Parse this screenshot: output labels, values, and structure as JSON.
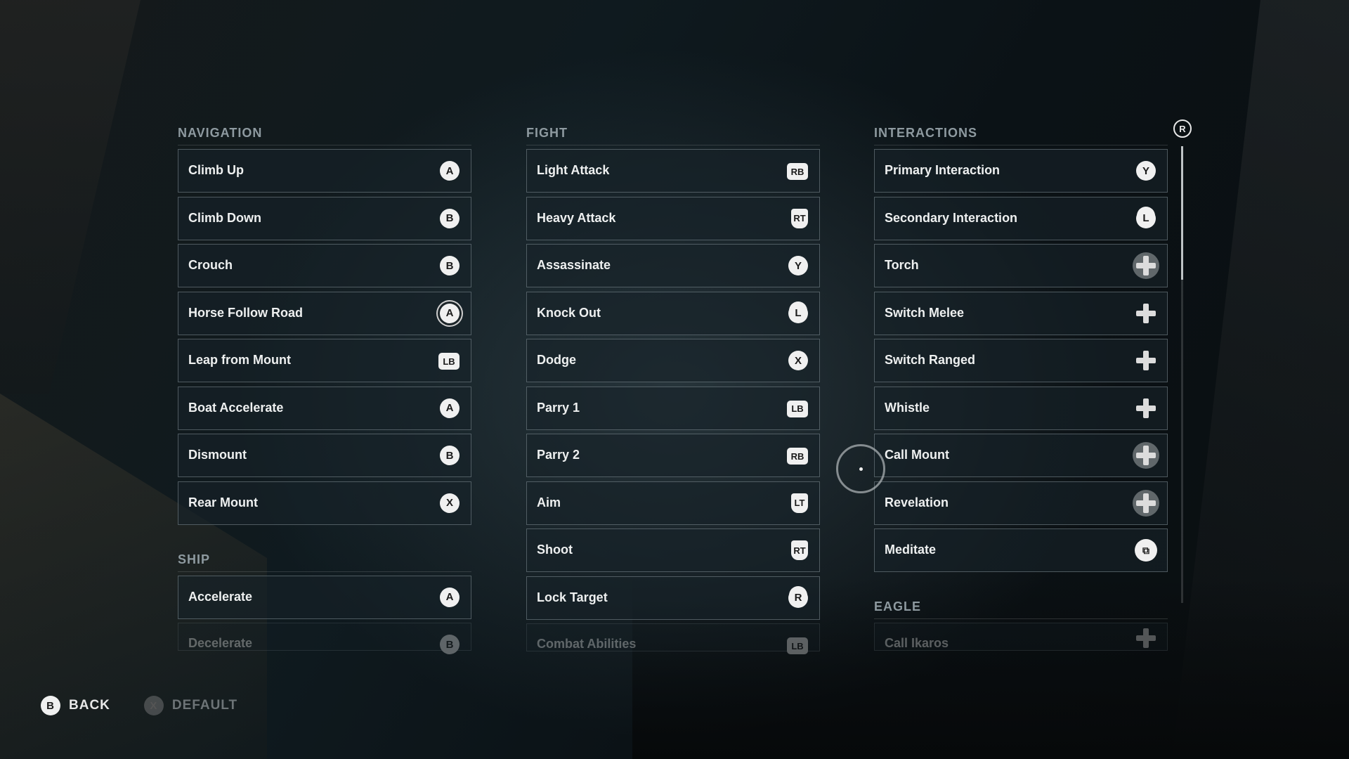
{
  "sections": {
    "navigation": {
      "title": "NAVIGATION",
      "rows": [
        {
          "label": "Climb Up",
          "button": "A"
        },
        {
          "label": "Climb Down",
          "button": "B"
        },
        {
          "label": "Crouch",
          "button": "B"
        },
        {
          "label": "Horse Follow Road",
          "button": "A"
        },
        {
          "label": "Leap from Mount",
          "button": "LB"
        },
        {
          "label": "Boat Accelerate",
          "button": "A"
        },
        {
          "label": "Dismount",
          "button": "B"
        },
        {
          "label": "Rear Mount",
          "button": "X"
        }
      ]
    },
    "ship": {
      "title": "SHIP",
      "rows": [
        {
          "label": "Accelerate",
          "button": "A"
        },
        {
          "label": "Decelerate",
          "button": "B"
        }
      ]
    },
    "fight": {
      "title": "FIGHT",
      "rows": [
        {
          "label": "Light Attack",
          "button": "RB"
        },
        {
          "label": "Heavy Attack",
          "button": "RT"
        },
        {
          "label": "Assassinate",
          "button": "Y"
        },
        {
          "label": "Knock Out",
          "button": "L"
        },
        {
          "label": "Dodge",
          "button": "X"
        },
        {
          "label": "Parry 1",
          "button": "LB"
        },
        {
          "label": "Parry 2",
          "button": "RB"
        },
        {
          "label": "Aim",
          "button": "LT"
        },
        {
          "label": "Shoot",
          "button": "RT"
        },
        {
          "label": "Lock Target",
          "button": "R"
        },
        {
          "label": "Combat Abilities",
          "button": "LB"
        }
      ]
    },
    "interactions": {
      "title": "INTERACTIONS",
      "rows": [
        {
          "label": "Primary Interaction",
          "button": "Y"
        },
        {
          "label": "Secondary Interaction",
          "button": "L"
        },
        {
          "label": "Torch",
          "button": "dpad-right"
        },
        {
          "label": "Switch Melee",
          "button": "dpad-left"
        },
        {
          "label": "Switch Ranged",
          "button": "dpad-right"
        },
        {
          "label": "Whistle",
          "button": "dpad-up"
        },
        {
          "label": "Call Mount",
          "button": "dpad-down"
        },
        {
          "label": "Revelation",
          "button": "dpad-up"
        },
        {
          "label": "Meditate",
          "button": "view-icon"
        }
      ]
    },
    "eagle": {
      "title": "EAGLE",
      "rows": [
        {
          "label": "Call Ikaros",
          "button": "dpad-up"
        }
      ]
    }
  },
  "scroll": {
    "stick_label": "R"
  },
  "footer": {
    "back": {
      "button": "B",
      "label": "BACK"
    },
    "default": {
      "button": "X",
      "label": "DEFAULT"
    }
  }
}
